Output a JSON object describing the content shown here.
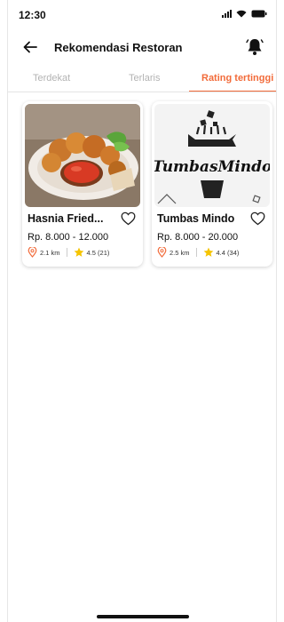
{
  "status_bar": {
    "time": "12:30"
  },
  "header": {
    "title": "Rekomendasi Restoran"
  },
  "tabs": [
    {
      "label": "Terdekat",
      "active": false
    },
    {
      "label": "Terlaris",
      "active": false
    },
    {
      "label": "Rating tertinggi",
      "active": true
    }
  ],
  "restaurants": [
    {
      "name": "Hasnia Fried...",
      "price": "Rp. 8.000 - 12.000",
      "distance": "2.1 km",
      "rating": "4.5 (21)",
      "image": "fried-chicken-photo"
    },
    {
      "name": "Tumbas Mindo",
      "price": "Rp. 8.000 - 20.000",
      "distance": "2.5 km",
      "rating": "4.4 (34)",
      "image": "tumbas-mindo-logo",
      "logo_text": "TumbasMindo"
    }
  ],
  "colors": {
    "accent": "#f26b3a",
    "star": "#f5c400",
    "inactive_tab": "#b3b3b3"
  }
}
